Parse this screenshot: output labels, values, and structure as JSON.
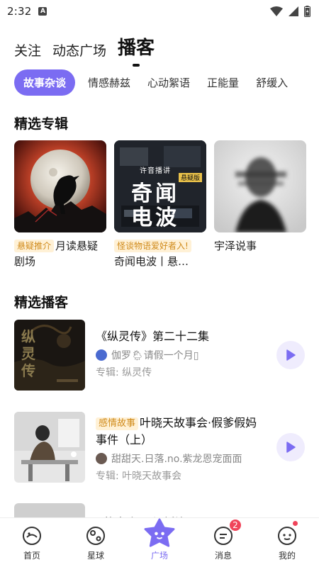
{
  "status_bar": {
    "time": "2:32",
    "notif_letter": "A"
  },
  "top_tabs": [
    {
      "label": "关注",
      "active": false
    },
    {
      "label": "动态广场",
      "active": false
    },
    {
      "label": "播客",
      "active": true
    }
  ],
  "chips": [
    {
      "label": "故事杂谈",
      "active": true
    },
    {
      "label": "情感赫兹",
      "active": false
    },
    {
      "label": "心动絮语",
      "active": false
    },
    {
      "label": "正能量",
      "active": false
    },
    {
      "label": "舒缓入",
      "active": false
    }
  ],
  "albums_section": {
    "title": "精选专辑",
    "items": [
      {
        "tag": "悬疑推介",
        "title": "月读悬疑剧场",
        "cover_icon": "crow-moon-cover"
      },
      {
        "tag": "怪谈物语爱好者入!",
        "title": "奇闻电波丨悬…",
        "cover_icon": "radio-studio-cover",
        "cover_small": "许音播讲",
        "cover_badge": "悬疑版",
        "cover_big_1": "奇闻",
        "cover_big_2": "电波"
      },
      {
        "tag": "",
        "title": "宇泽说事",
        "cover_icon": "blurred-face-cover"
      }
    ]
  },
  "podcasts_section": {
    "title": "精选播客",
    "items": [
      {
        "tag": "",
        "title": "《纵灵传》第二十二集",
        "author": "伽罗🌦请假一个月▯",
        "album": "专辑: 纵灵传",
        "cover_text": "纵灵传"
      },
      {
        "tag": "感情故事",
        "title": "叶晓天故事会·假爹假妈事件（上）",
        "author": "甜甜天.日落.no.紫龙恩宠面面",
        "album": "专辑: 叶晓天故事会"
      },
      {
        "tag": "",
        "title": "Ⅲ故事会·？福播连",
        "author": "",
        "album": ""
      }
    ]
  },
  "bottom_nav": [
    {
      "label": "首页",
      "icon": "home-planet-icon",
      "active": false
    },
    {
      "label": "星球",
      "icon": "planet-icon",
      "active": false
    },
    {
      "label": "广场",
      "icon": "star-square-icon",
      "active": true
    },
    {
      "label": "消息",
      "icon": "message-icon",
      "active": false,
      "badge": "2"
    },
    {
      "label": "我的",
      "icon": "profile-icon",
      "active": false,
      "dot": true
    }
  ],
  "colors": {
    "accent": "#7b6cf2",
    "tag_text": "#d08a1a",
    "tag_bg": "#fff1d6",
    "badge": "#f0445a"
  }
}
